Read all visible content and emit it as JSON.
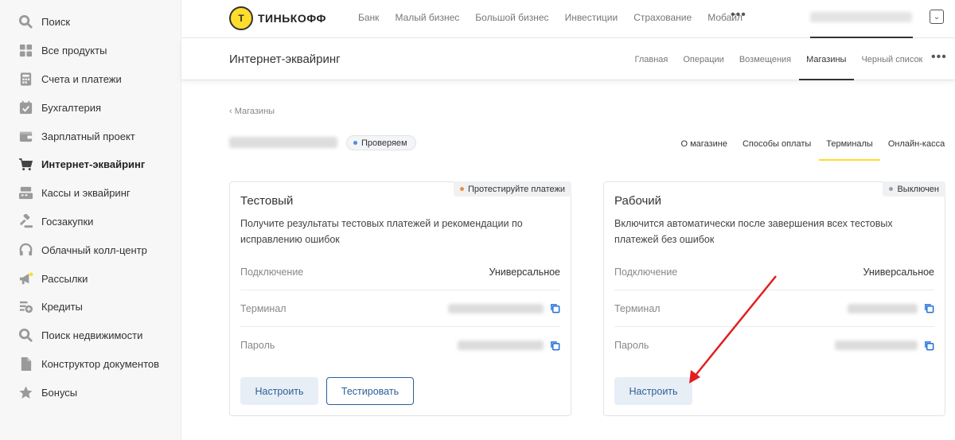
{
  "sidebar": {
    "items": [
      {
        "label": "Поиск",
        "icon": "search-icon"
      },
      {
        "label": "Все продукты",
        "icon": "grid-icon"
      },
      {
        "label": "Счета и платежи",
        "icon": "calculator-icon"
      },
      {
        "label": "Бухгалтерия",
        "icon": "calendar-check-icon"
      },
      {
        "label": "Зарплатный проект",
        "icon": "wallet-icon"
      },
      {
        "label": "Интернет-эквайринг",
        "icon": "cart-icon",
        "active": true
      },
      {
        "label": "Кассы и эквайринг",
        "icon": "register-icon"
      },
      {
        "label": "Госзакупки",
        "icon": "gavel-icon"
      },
      {
        "label": "Облачный колл-центр",
        "icon": "headset-icon"
      },
      {
        "label": "Рассылки",
        "icon": "megaphone-icon"
      },
      {
        "label": "Кредиты",
        "icon": "credit-plus-icon"
      },
      {
        "label": "Поиск недвижимости",
        "icon": "search-icon"
      },
      {
        "label": "Конструктор документов",
        "icon": "document-icon"
      },
      {
        "label": "Бонусы",
        "icon": "star-icon"
      }
    ]
  },
  "header": {
    "logo_text": "ТИНЬКОФФ",
    "nav": [
      "Банк",
      "Малый бизнес",
      "Большой бизнес",
      "Инвестиции",
      "Страхование",
      "Мобайл"
    ],
    "more": "•••"
  },
  "subheader": {
    "title": "Интернет-эквайринг",
    "tabs": [
      "Главная",
      "Операции",
      "Возмещения",
      "Магазины",
      "Черный список"
    ],
    "active_tab": "Магазины",
    "more": "•••"
  },
  "breadcrumb": "‹ Магазины",
  "store": {
    "status": "Проверяем",
    "status_color": "#4a90e2",
    "tabs": [
      "О магазине",
      "Способы оплаты",
      "Терминалы",
      "Онлайн-касса"
    ],
    "active_tab": "Терминалы"
  },
  "cards": [
    {
      "badge": "Протестируйте платежи",
      "badge_dot_color": "#f08c3a",
      "title": "Тестовый",
      "desc": "Получите результаты тестовых платежей и рекомендации по исправлению ошибок",
      "connection_label": "Подключение",
      "connection_value": "Универсальное",
      "terminal_label": "Терминал",
      "password_label": "Пароль",
      "buttons": [
        "Настроить",
        "Тестировать"
      ]
    },
    {
      "badge": "Выключен",
      "badge_dot_color": "#9aa0a8",
      "title": "Рабочий",
      "desc": "Включится автоматически после завершения всех тестовых платежей без ошибок",
      "connection_label": "Подключение",
      "connection_value": "Универсальное",
      "terminal_label": "Терминал",
      "password_label": "Пароль",
      "buttons": [
        "Настроить"
      ]
    }
  ],
  "colors": {
    "accent_yellow": "#ffdd2d",
    "button_text": "#2a5f99",
    "copy_icon": "#1e6fd9",
    "annotation_arrow": "#e02020"
  }
}
